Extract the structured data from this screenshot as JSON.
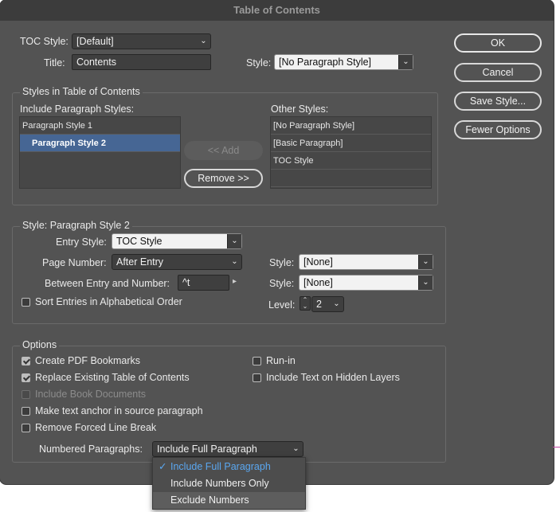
{
  "window": {
    "title": "Table of Contents"
  },
  "top": {
    "toc_style_label": "TOC Style:",
    "toc_style_value": "[Default]",
    "title_label": "Title:",
    "title_value": "Contents",
    "style_label": "Style:",
    "style_value": "[No Paragraph Style]"
  },
  "buttons": {
    "ok": "OK",
    "cancel": "Cancel",
    "save_style": "Save Style...",
    "fewer_options": "Fewer Options"
  },
  "styles_group": {
    "title": "Styles in Table of Contents",
    "include_label": "Include Paragraph Styles:",
    "include_items": [
      "Paragraph Style 1",
      "Paragraph Style 2"
    ],
    "other_label": "Other Styles:",
    "other_items": [
      "[No Paragraph Style]",
      "[Basic Paragraph]",
      "TOC Style"
    ],
    "add_button": "<< Add",
    "remove_button": "Remove >>"
  },
  "style_group": {
    "title": "Style: Paragraph Style 2",
    "entry_style_label": "Entry Style:",
    "entry_style_value": "TOC Style",
    "page_number_label": "Page Number:",
    "page_number_value": "After Entry",
    "between_label": "Between Entry and Number:",
    "between_value": "^t",
    "sort_label": "Sort Entries in Alphabetical Order",
    "style1_label": "Style:",
    "style1_value": "[None]",
    "style2_label": "Style:",
    "style2_value": "[None]",
    "level_label": "Level:",
    "level_value": "2"
  },
  "options_group": {
    "title": "Options",
    "create_pdf": "Create PDF Bookmarks",
    "replace_existing": "Replace Existing Table of Contents",
    "include_book": "Include Book Documents",
    "make_anchor": "Make text anchor in source paragraph",
    "remove_break": "Remove Forced Line Break",
    "run_in": "Run-in",
    "include_hidden": "Include Text on Hidden Layers",
    "numbered_label": "Numbered Paragraphs:",
    "numbered_value": "Include Full Paragraph"
  },
  "numbered_menu": {
    "items": [
      "Include Full Paragraph",
      "Include Numbers Only",
      "Exclude Numbers"
    ],
    "checkmark": "✓"
  },
  "glyphs": {
    "chevron": "⌄",
    "arrow_right": "▸",
    "up": "⌃",
    "down": "⌄"
  }
}
